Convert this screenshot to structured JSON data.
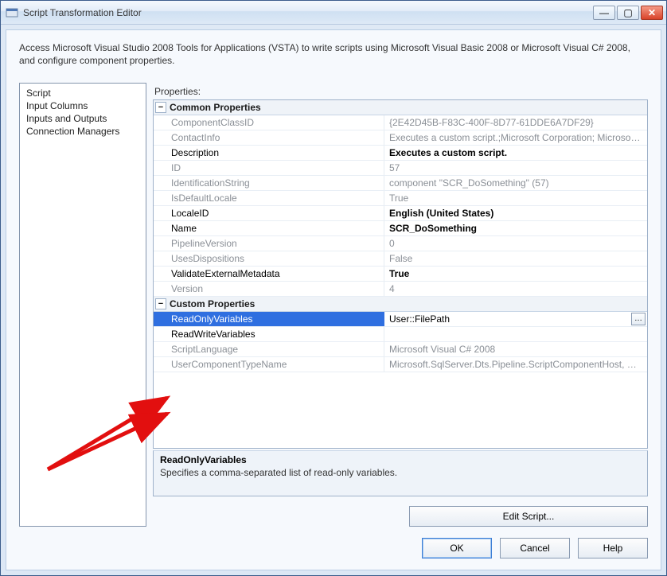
{
  "window": {
    "title": "Script Transformation Editor"
  },
  "intro": "Access Microsoft Visual Studio 2008 Tools for Applications (VSTA) to write scripts using Microsoft Visual Basic 2008 or Microsoft Visual C# 2008, and configure component properties.",
  "nav": {
    "items": [
      "Script",
      "Input Columns",
      "Inputs and Outputs",
      "Connection Managers"
    ]
  },
  "props_label": "Properties:",
  "categories": [
    {
      "name": "Common Properties",
      "expanded": true,
      "props": [
        {
          "k": "ComponentClassID",
          "v": "{2E42D45B-F83C-400F-8D77-61DDE6A7DF29}",
          "dim": true
        },
        {
          "k": "ContactInfo",
          "v": "Executes a custom script.;Microsoft Corporation; Microsoft S",
          "dim": true
        },
        {
          "k": "Description",
          "v": "Executes a custom script.",
          "boldv": true
        },
        {
          "k": "ID",
          "v": "57",
          "dim": true
        },
        {
          "k": "IdentificationString",
          "v": "component \"SCR_DoSomething\" (57)",
          "dim": true
        },
        {
          "k": "IsDefaultLocale",
          "v": "True",
          "dim": true
        },
        {
          "k": "LocaleID",
          "v": "English (United States)",
          "boldv": true
        },
        {
          "k": "Name",
          "v": "SCR_DoSomething",
          "boldv": true
        },
        {
          "k": "PipelineVersion",
          "v": "0",
          "dim": true
        },
        {
          "k": "UsesDispositions",
          "v": "False",
          "dim": true
        },
        {
          "k": "ValidateExternalMetadata",
          "v": "True",
          "boldv": true
        },
        {
          "k": "Version",
          "v": "4",
          "dim": true
        }
      ]
    },
    {
      "name": "Custom Properties",
      "expanded": true,
      "props": [
        {
          "k": "ReadOnlyVariables",
          "v": "User::FilePath",
          "selected": true,
          "ellipsis": true
        },
        {
          "k": "ReadWriteVariables",
          "v": ""
        },
        {
          "k": "ScriptLanguage",
          "v": "Microsoft Visual C# 2008",
          "dim": true
        },
        {
          "k": "UserComponentTypeName",
          "v": "Microsoft.SqlServer.Dts.Pipeline.ScriptComponentHost, Micr",
          "dim": true
        }
      ]
    }
  ],
  "help": {
    "title": "ReadOnlyVariables",
    "desc": "Specifies a comma-separated list of read-only variables."
  },
  "buttons": {
    "edit_script": "Edit Script...",
    "ok": "OK",
    "cancel": "Cancel",
    "help": "Help"
  },
  "icons": {
    "minimize": "—",
    "maximize": "▢",
    "close": "✕",
    "collapse": "−",
    "ellipsis": "…"
  }
}
